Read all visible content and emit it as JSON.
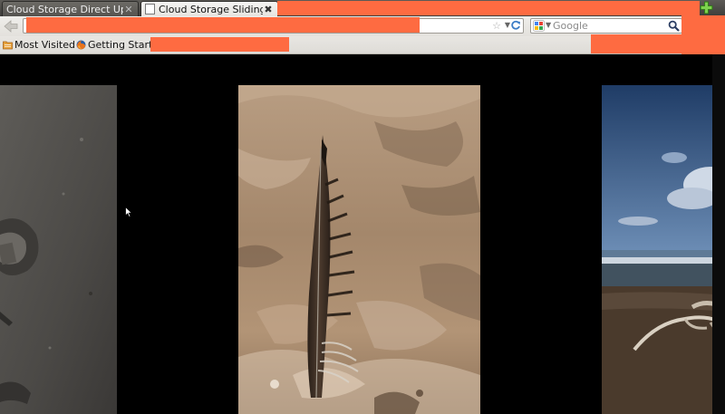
{
  "tabs": [
    {
      "title": "Cloud Storage Direct Uploa…",
      "active": false
    },
    {
      "title": "Cloud Storage Sliding Imag…",
      "active": true
    }
  ],
  "navbar": {
    "search_placeholder": "Google"
  },
  "bookmarks": {
    "items": [
      {
        "label": "Most Visited",
        "icon": "folder-icon",
        "has_dropdown": true
      },
      {
        "label": "Getting Started",
        "icon": "firefox-icon"
      }
    ]
  },
  "colors": {
    "redaction": "#fe6b41",
    "page_background": "#000000"
  },
  "slideshow": {
    "slides": [
      {
        "subject": "sand-with-debris",
        "position": "previous"
      },
      {
        "subject": "feather-in-sand",
        "position": "current"
      },
      {
        "subject": "beach-with-driftwood",
        "position": "next"
      }
    ]
  }
}
